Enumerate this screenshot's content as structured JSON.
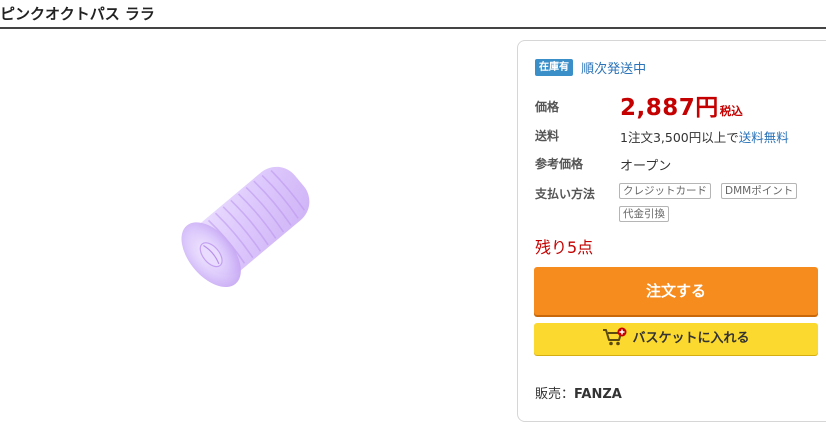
{
  "product": {
    "title": "ピンクオクトパス ララ"
  },
  "panel": {
    "stock_badge": "在庫有",
    "stock_status": "順次発送中",
    "price_label": "価格",
    "price_value": "2,887円",
    "price_tax": "税込",
    "shipping_label": "送料",
    "shipping_text": "1注文3,500円以上で",
    "shipping_free": "送料無料",
    "reference_price_label": "参考価格",
    "reference_price_value": "オープン",
    "payment_label": "支払い方法",
    "payment_methods": [
      "クレジットカード",
      "DMMポイント",
      "代金引換"
    ],
    "remaining": "残り5点",
    "order_button": "注文する",
    "basket_button": "バスケットに入れる",
    "seller_label": "販売：",
    "seller_name": "FANZA"
  },
  "colors": {
    "price": "#c40000",
    "link": "#2a73b8",
    "order_button": "#f78c1e",
    "basket_button": "#fbd92e",
    "stock_badge": "#3a8fc8"
  },
  "icons": {
    "basket": "shopping-cart-plus-icon"
  }
}
